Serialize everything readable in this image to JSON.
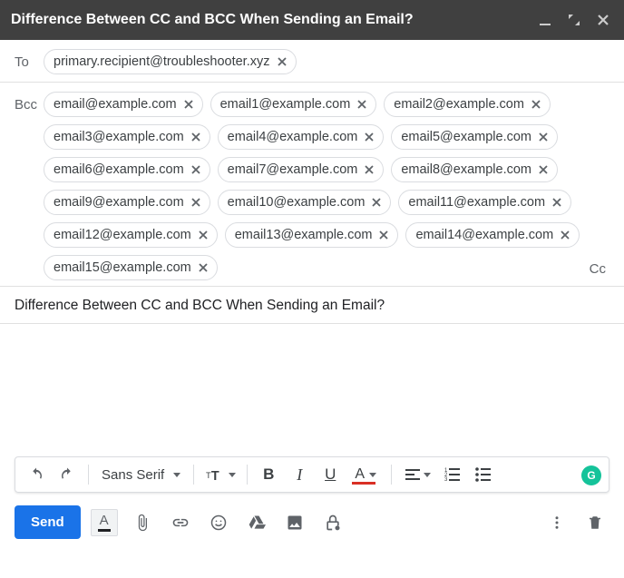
{
  "titlebar": {
    "title": "Difference Between CC and BCC When Sending an Email?"
  },
  "to": {
    "label": "To",
    "chips": [
      "primary.recipient@troubleshooter.xyz"
    ]
  },
  "bcc": {
    "label": "Bcc",
    "chips": [
      "email@example.com",
      "email1@example.com",
      "email2@example.com",
      "email3@example.com",
      "email4@example.com",
      "email5@example.com",
      "email6@example.com",
      "email7@example.com",
      "email8@example.com",
      "email9@example.com",
      "email10@example.com",
      "email11@example.com",
      "email12@example.com",
      "email13@example.com",
      "email14@example.com",
      "email15@example.com"
    ],
    "cc_link": "Cc"
  },
  "subject": "Difference Between CC and BCC When Sending an Email?",
  "format": {
    "font": "Sans Serif"
  },
  "send": {
    "label": "Send"
  }
}
